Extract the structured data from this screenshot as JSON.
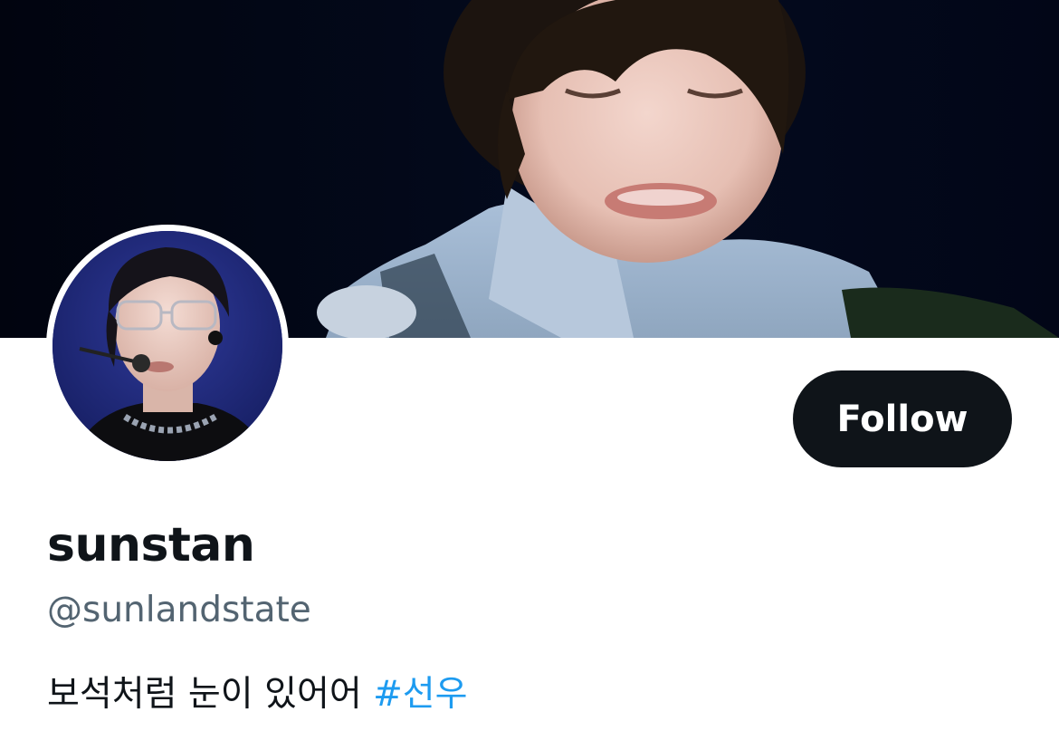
{
  "profile": {
    "display_name": "sunstan",
    "handle": "@sunlandstate",
    "bio_text": "보석처럼 눈이 있어어 ",
    "bio_hashtag": "#선우"
  },
  "actions": {
    "follow_label": "Follow"
  },
  "colors": {
    "text_primary": "#0f1419",
    "text_secondary": "#536471",
    "link": "#1d9bf0",
    "button_bg": "#0f1419",
    "banner_bg": "#020617"
  }
}
